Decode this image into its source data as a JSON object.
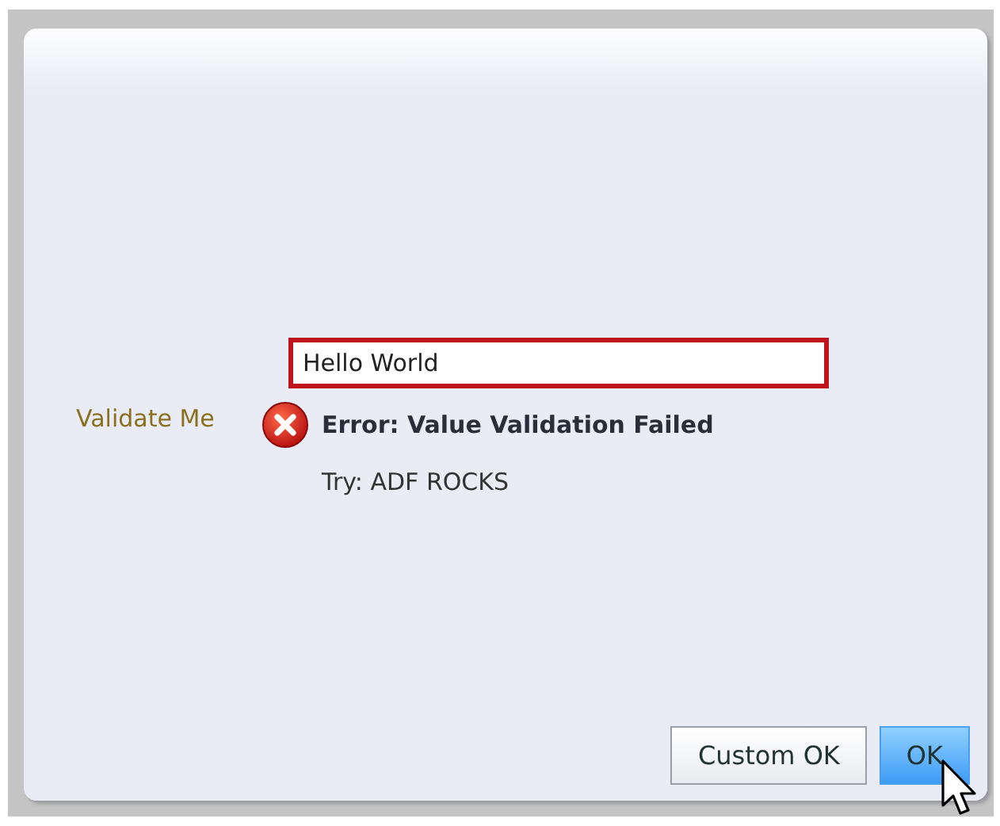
{
  "dialog": {
    "field": {
      "label": "Validate Me",
      "value": "Hello World",
      "invalid": true
    },
    "error": {
      "message": "Error: Value Validation Failed",
      "hint": "Try: ADF ROCKS"
    },
    "buttons": [
      {
        "label": "Custom OK",
        "hovered": false
      },
      {
        "label": "OK",
        "hovered": true
      }
    ]
  }
}
